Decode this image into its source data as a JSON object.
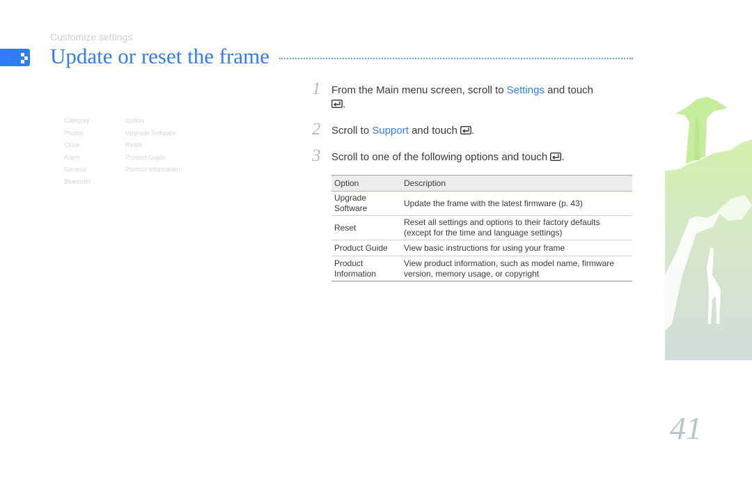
{
  "header": {
    "section": "Customize settings",
    "title": "Update or reset the frame"
  },
  "nav": {
    "categories": [
      "Category",
      "Photos",
      "Clock",
      "Alarm",
      "General",
      "Bluetooth"
    ],
    "options": [
      "Option",
      "Upgrade Software",
      "Reset",
      "Product Guide",
      "Product Information"
    ]
  },
  "steps": [
    {
      "num": "1",
      "pre": "From the Main menu screen, scroll to ",
      "highlight": "Settings",
      "post": " and touch",
      "after_icon": "."
    },
    {
      "num": "2",
      "pre": "Scroll to ",
      "highlight": "Support",
      "post": " and touch ",
      "after_icon": "."
    },
    {
      "num": "3",
      "pre": "Scroll to one of the following options and touch ",
      "highlight": "",
      "post": "",
      "after_icon": "."
    }
  ],
  "icons": {
    "enter": "enter-key-icon",
    "tab": "chapter-tab-icon"
  },
  "table": {
    "headers": [
      "Option",
      "Description"
    ],
    "rows": [
      {
        "option": [
          "Upgrade",
          "Software"
        ],
        "description": [
          "Update the frame with the latest firmware (p. 43)"
        ]
      },
      {
        "option": [
          "Reset"
        ],
        "description": [
          "Reset all settings and options to their factory defaults",
          "(except for the time and language settings)"
        ]
      },
      {
        "option": [
          "Product Guide"
        ],
        "description": [
          "View basic instructions for using your frame"
        ]
      },
      {
        "option": [
          "Product",
          "Information"
        ],
        "description": [
          "View product information, such as model name, firmware",
          "version, memory usage, or copyright"
        ]
      }
    ]
  },
  "page_number": "41",
  "colors": {
    "accent": "#2f7cf6",
    "art_green": "#c9eba6",
    "art_gray": "#d3dcdc"
  }
}
